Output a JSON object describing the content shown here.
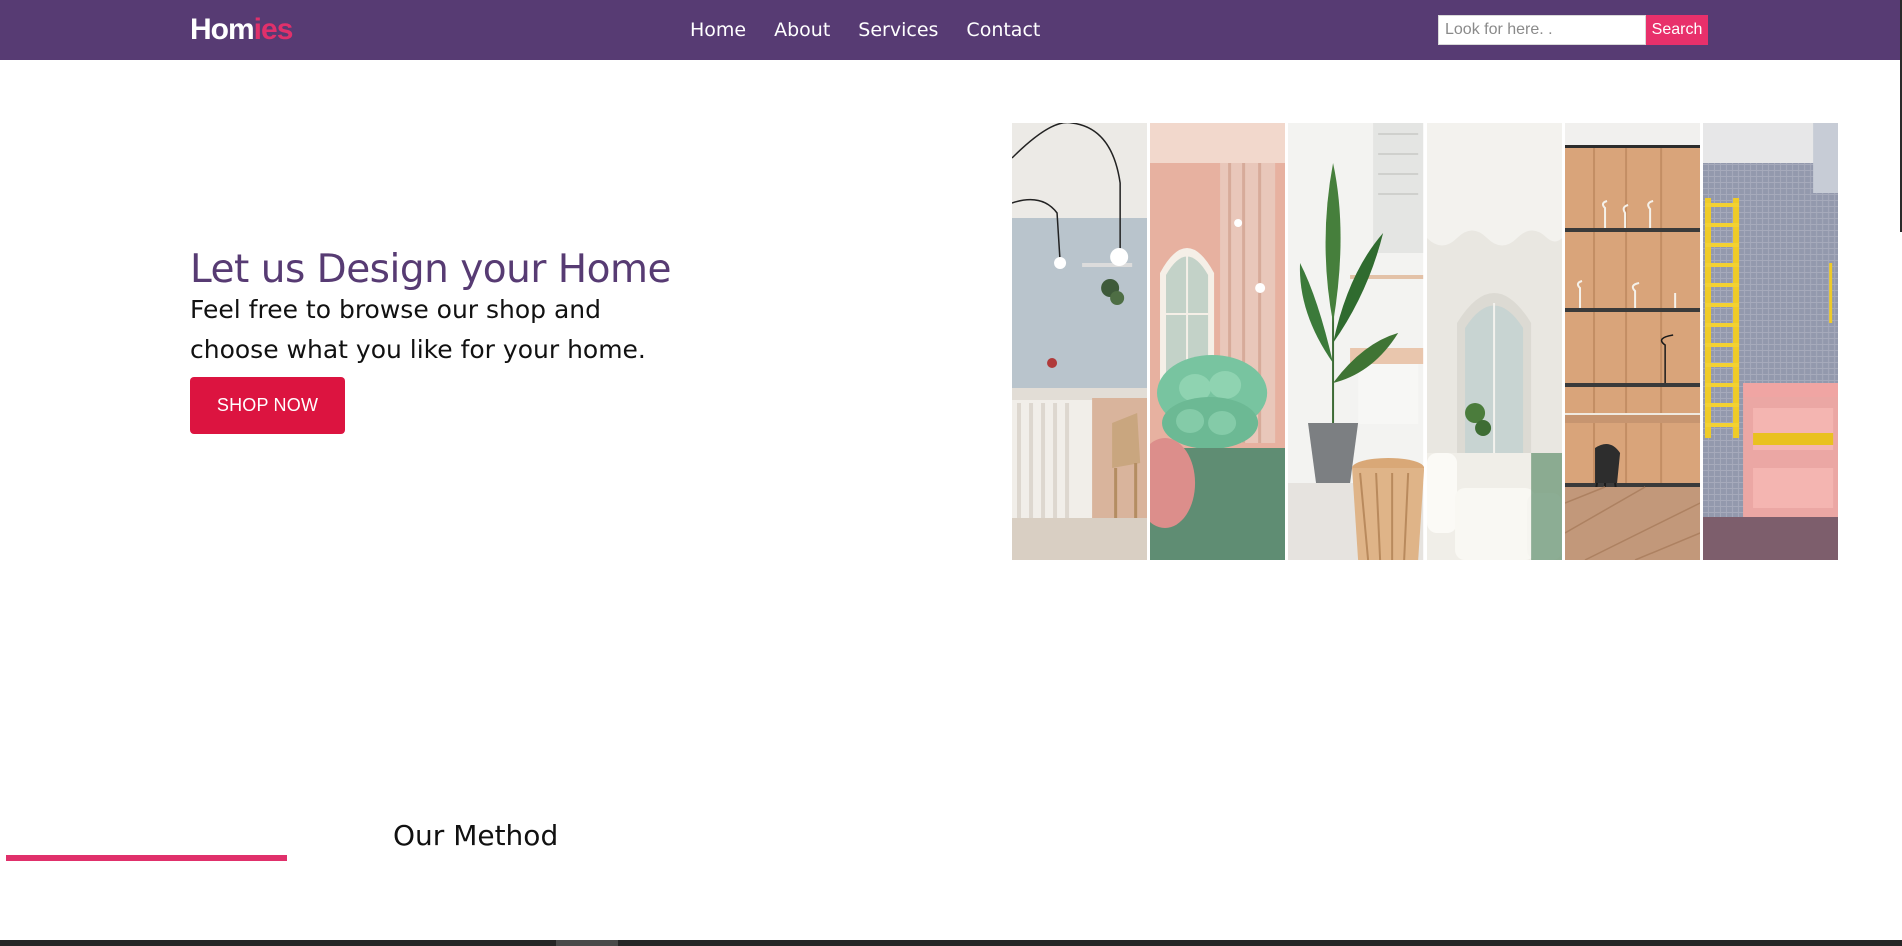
{
  "navbar": {
    "logo_part1": "Hom",
    "logo_part2": "ies",
    "links": [
      "Home",
      "About",
      "Services",
      "Contact"
    ],
    "search_placeholder": "Look for here. .",
    "search_button": "Search"
  },
  "hero": {
    "title": "Let us Design your Home",
    "text": "Feel free to browse our shop and choose what you like for your home.",
    "cta": "SHOP NOW"
  },
  "gallery": {
    "panels": [
      "interior-photo-1",
      "interior-photo-2",
      "interior-photo-3",
      "interior-photo-4",
      "interior-photo-5",
      "interior-photo-6"
    ]
  },
  "method": {
    "title": "Our Method"
  },
  "colors": {
    "nav_bg": "#573b73",
    "brand_pink": "#e0306b",
    "cta_red": "#dc1440",
    "title_purple": "#573b73"
  }
}
